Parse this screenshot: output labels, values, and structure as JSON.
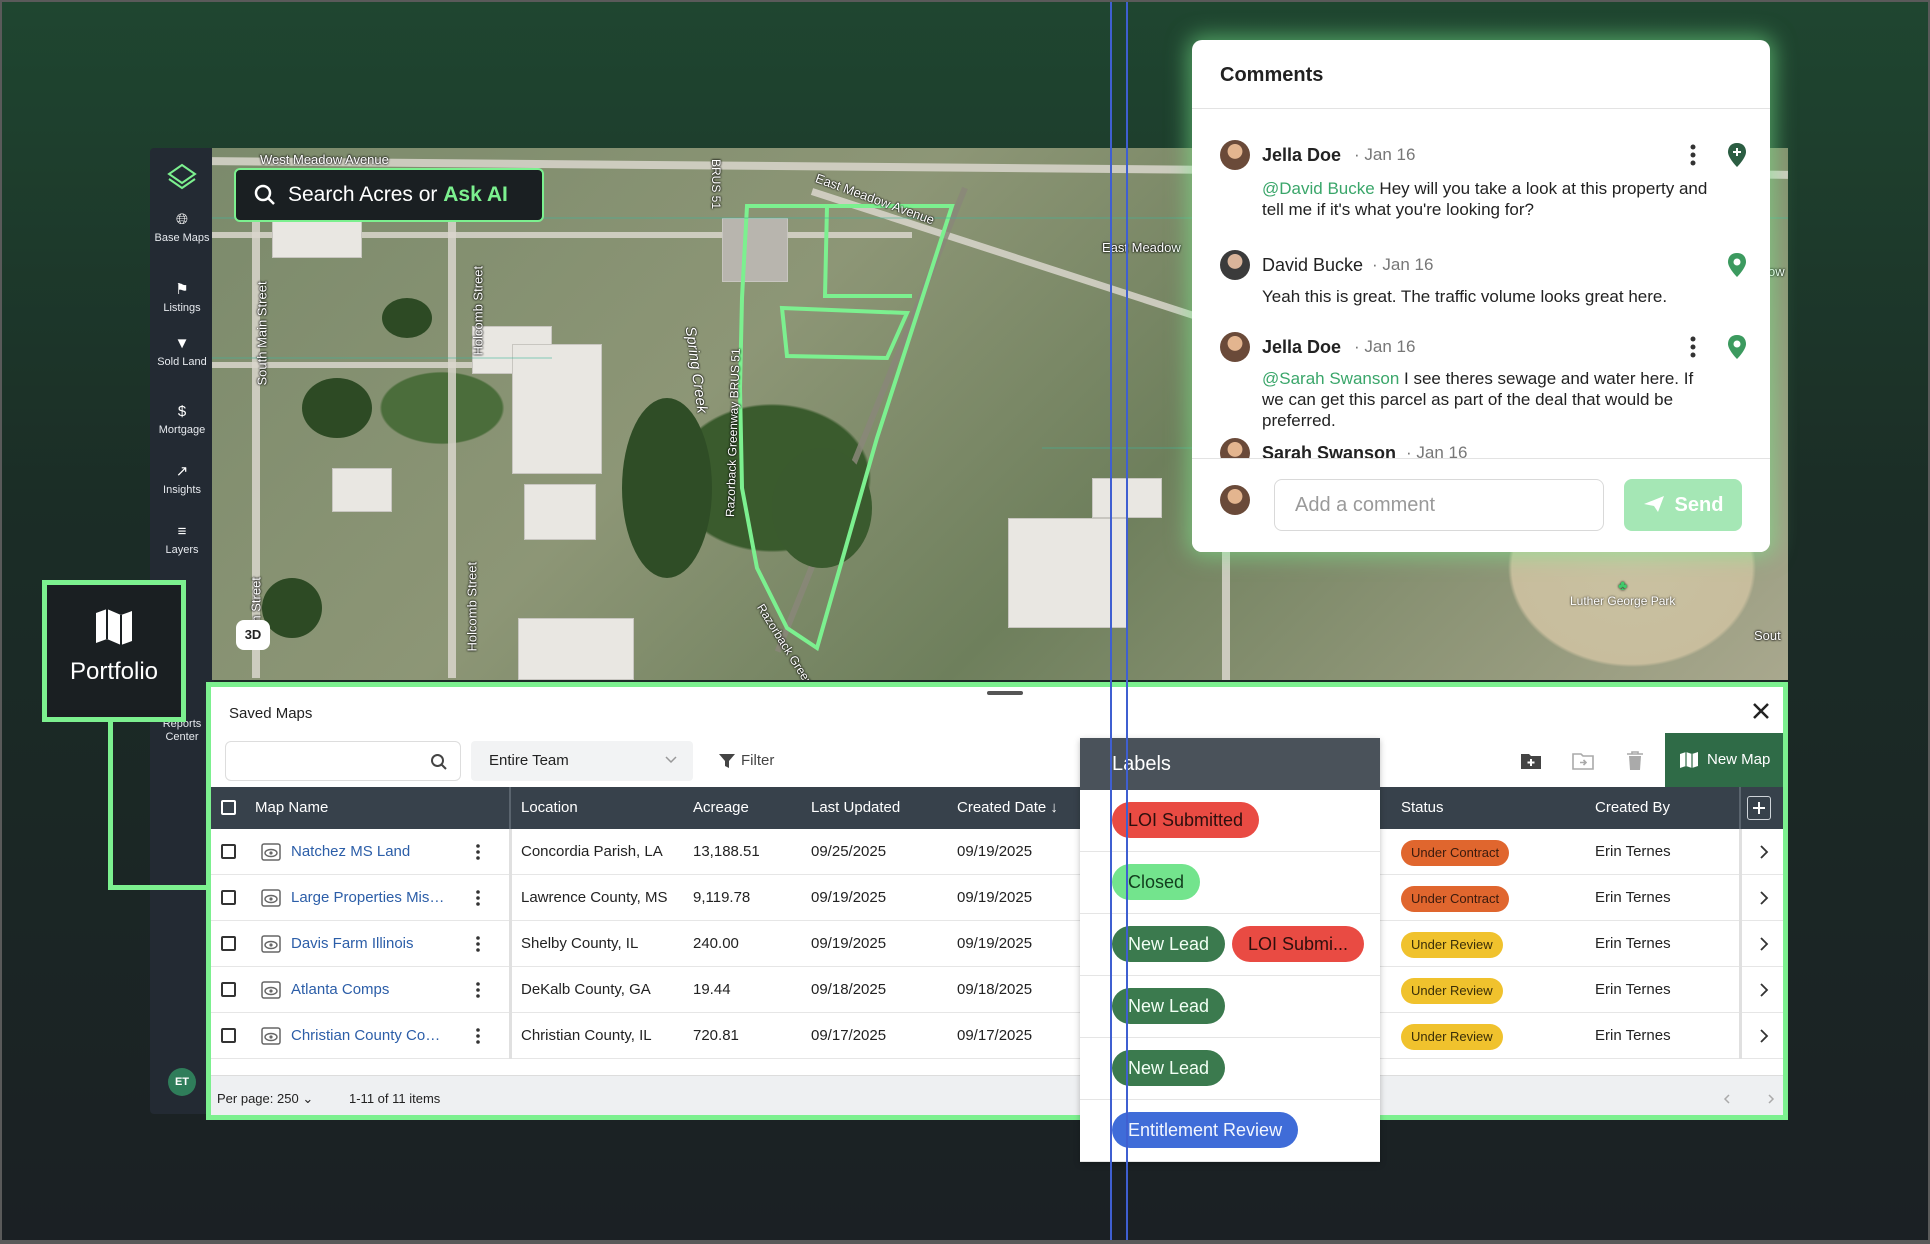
{
  "rail": {
    "items": [
      {
        "label": "Base Maps",
        "icon": "globe-icon"
      },
      {
        "label": "Listings",
        "icon": "flag-icon"
      },
      {
        "label": "Sold Land",
        "icon": "location-pin-icon"
      },
      {
        "label": "Mortgage",
        "icon": "dollar-icon"
      },
      {
        "label": "Insights",
        "icon": "trend-line-icon"
      },
      {
        "label": "Layers",
        "icon": "layers-icon"
      }
    ],
    "reports_label": "Reports Center",
    "avatar_initials": "ET"
  },
  "map": {
    "search_prefix": "Search Acres or ",
    "search_ai": "Ask AI",
    "btn_3d": "3D",
    "streets": [
      "West Meadow Avenue",
      "East Meadow Avenue",
      "East Meadow",
      "South Main Street",
      "Holcomb Street",
      "Spring Creek",
      "Razorback Greenway BRUS 51",
      "BRUS 51",
      "Razorback Green",
      "Holcomb Street",
      "in Street",
      "Sout",
      "ow"
    ],
    "park_label": "Luther George Park"
  },
  "comments": {
    "title": "Comments",
    "items": [
      {
        "author": "Jella Doe",
        "date": "Jan 16",
        "mention": "@David Bucke",
        "text": " Hey will you take a look at this property and tell me if it's what you're looking for?"
      },
      {
        "author": "David Bucke",
        "date": "Jan 16",
        "mention": "",
        "text": "Yeah this is great. The traffic volume looks great here."
      },
      {
        "author": "Jella Doe",
        "date": "Jan 16",
        "mention": "@Sarah Swanson",
        "text": " I see theres sewage and water here. If we can get this parcel as part of the deal that would be preferred."
      },
      {
        "author": "Sarah Swanson",
        "date": "Jan 16",
        "mention": "",
        "text": ""
      }
    ],
    "placeholder": "Add a comment",
    "send_label": "Send"
  },
  "portfolio_callout": {
    "label": "Portfolio",
    "rail_fragment": "olio"
  },
  "saved_maps": {
    "title": "Saved Maps",
    "team_select": "Entire Team",
    "filter_label": "Filter",
    "new_map_label": "New Map",
    "columns": [
      "Map Name",
      "Location",
      "Acreage",
      "Last Updated",
      "Created Date",
      "Status",
      "Created By"
    ],
    "rows": [
      {
        "name": "Natchez MS Land",
        "location": "Concordia Parish, LA",
        "acreage": "13,188.51",
        "updated": "09/25/2025",
        "created": "09/19/2025",
        "status": "Under Contract",
        "created_by": "Erin Ternes"
      },
      {
        "name": "Large Properties Mis…",
        "location": "Lawrence County, MS",
        "acreage": "9,119.78",
        "updated": "09/19/2025",
        "created": "09/19/2025",
        "status": "Under Contract",
        "created_by": "Erin Ternes"
      },
      {
        "name": "Davis Farm Illinois",
        "location": "Shelby County, IL",
        "acreage": "240.00",
        "updated": "09/19/2025",
        "created": "09/19/2025",
        "status": "Under Review",
        "created_by": "Erin Ternes"
      },
      {
        "name": "Atlanta Comps",
        "location": "DeKalb County, GA",
        "acreage": "19.44",
        "updated": "09/18/2025",
        "created": "09/18/2025",
        "status": "Under Review",
        "created_by": "Erin Ternes"
      },
      {
        "name": "Christian County Co…",
        "location": "Christian County, IL",
        "acreage": "720.81",
        "updated": "09/17/2025",
        "created": "09/17/2025",
        "status": "Under Review",
        "created_by": "Erin Ternes"
      }
    ],
    "per_page": "Per page: 250",
    "items_count": "1-11 of 11 items"
  },
  "labels_panel": {
    "title": "Labels",
    "rows": [
      [
        {
          "text": "LOI Submitted",
          "color": "#e94b43"
        }
      ],
      [
        {
          "text": "Closed",
          "color": "#73e48d"
        }
      ],
      [
        {
          "text": "New Lead",
          "color": "#3b7a4e"
        },
        {
          "text": "LOI Submi...",
          "color": "#e94b43"
        }
      ],
      [
        {
          "text": "New Lead",
          "color": "#3b7a4e"
        }
      ],
      [
        {
          "text": "New Lead",
          "color": "#3b7a4e"
        }
      ],
      [
        {
          "text": "Entitlement Review",
          "color": "#3f6cd8"
        }
      ]
    ]
  },
  "colors": {
    "accent": "#7cf08f",
    "brand_dark": "#2f6b47",
    "header": "#37414b"
  }
}
